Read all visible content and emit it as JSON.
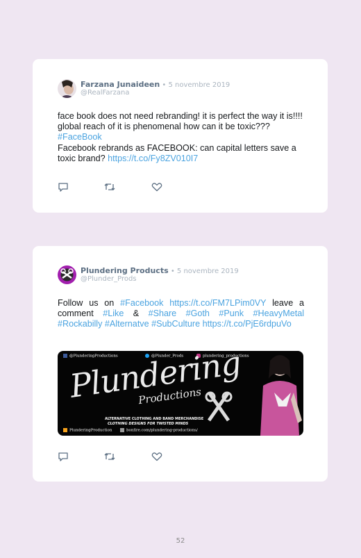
{
  "page": {
    "number": "52"
  },
  "tweets": [
    {
      "author": "Farzana Junaideen",
      "date": " • 5 novembre 2019",
      "handle": "@RealFarzana",
      "text_part1": "face book does not need rebranding! it is perfect the way it is!!!! global reach of it is phenomenal how can it be toxic???",
      "hashtag": "#FaceBook",
      "text_part2": "Facebook rebrands as FACEBOOK: can capital letters save a toxic brand?",
      "link": "https://t.co/Fy8ZV010I7"
    },
    {
      "author": "Plundering Products",
      "date": " • 5 novembre 2019",
      "handle": "@Plunder_Prods",
      "text_a": "Follow us on",
      "tag_facebook": "#Facebook",
      "link1": "https://t.co/FM7LPim0VY",
      "text_b": "leave a comment",
      "tag_like": "#Like",
      "text_amp": "&",
      "tag_share": "#Share",
      "tag_goth": "#Goth",
      "tag_punk": "#Punk",
      "tag_heavymetal": "#HeavyMetal",
      "tag_rockabilly": "#Rockabilly",
      "tag_alternatve": "#Alternatve",
      "tag_subculture": "#SubCulture",
      "link2": "https://t.co/PjE6rdpuVo",
      "media": {
        "top_left": "@PlunderingProductions",
        "top_mid": "@Plunder_Prods",
        "top_right": "plundering_productions",
        "title": "Plundering",
        "subtitle": "Productions",
        "tag1": "ALTERNATIVE CLOTHING AND BAND MERCHANDISE",
        "tag2": "CLOTHING DESIGNS FOR TWISTED MINDS",
        "bottom_left": "PlunderingProduction",
        "bottom_right": "bonfire.com/plundering-productions/"
      }
    }
  ],
  "colors": {
    "background": "#efe6f2",
    "card": "#ffffff",
    "link": "#4aa3e0",
    "name": "#5b6e82",
    "meta": "#aab4bf"
  },
  "icons": [
    "reply-icon",
    "retweet-icon",
    "like-icon"
  ]
}
